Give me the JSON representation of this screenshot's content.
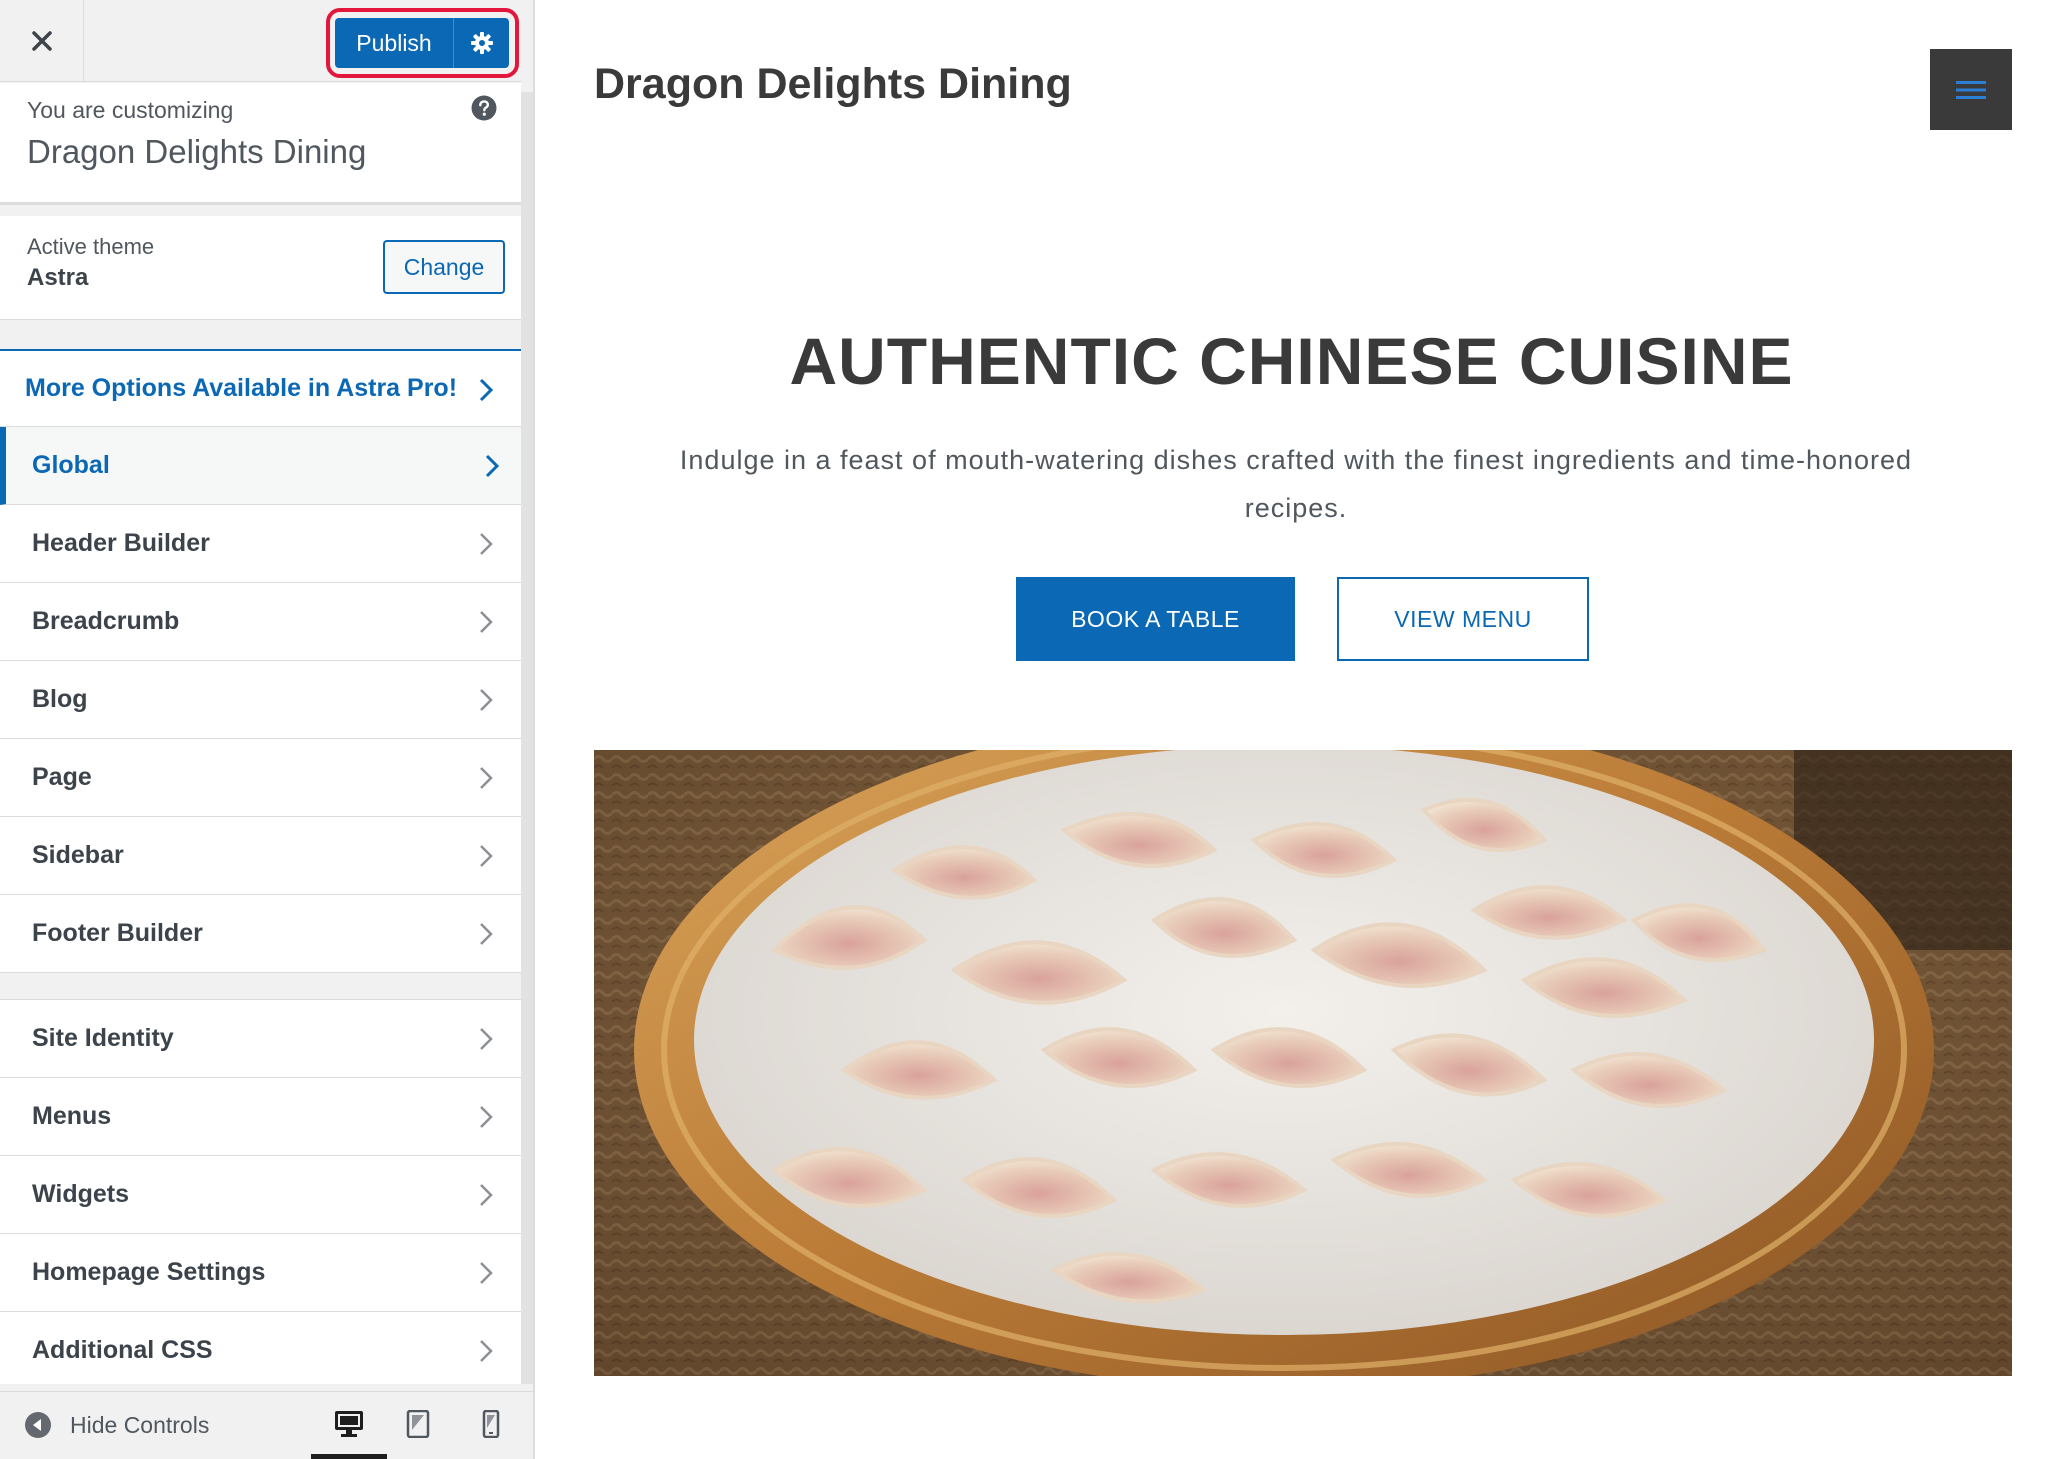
{
  "sidebar": {
    "publish_label": "Publish",
    "customizing_label": "You are customizing",
    "site_name": "Dragon Delights Dining",
    "active_theme_label": "Active theme",
    "theme_name": "Astra",
    "change_label": "Change",
    "pro_label": "More Options Available in Astra Pro!",
    "items": [
      {
        "label": "Global"
      },
      {
        "label": "Header Builder"
      },
      {
        "label": "Breadcrumb"
      },
      {
        "label": "Blog"
      },
      {
        "label": "Page"
      },
      {
        "label": "Sidebar"
      },
      {
        "label": "Footer Builder"
      }
    ],
    "items2": [
      {
        "label": "Site Identity"
      },
      {
        "label": "Menus"
      },
      {
        "label": "Widgets"
      },
      {
        "label": "Homepage Settings"
      },
      {
        "label": "Additional CSS"
      }
    ],
    "hide_controls_label": "Hide Controls",
    "devices": [
      "desktop-icon",
      "tablet-icon",
      "mobile-icon"
    ],
    "active_device": "desktop"
  },
  "preview": {
    "site_title": "Dragon Delights Dining",
    "hero_title": "AUTHENTIC CHINESE CUISINE",
    "hero_description": "Indulge in a feast of mouth-watering dishes crafted with the finest ingredients and time-honored recipes.",
    "primary_button": "BOOK A TABLE",
    "secondary_button": "VIEW MENU"
  },
  "colors": {
    "accent": "#0a68b5",
    "highlight": "#e3163d",
    "dark": "#3a3a3a"
  }
}
